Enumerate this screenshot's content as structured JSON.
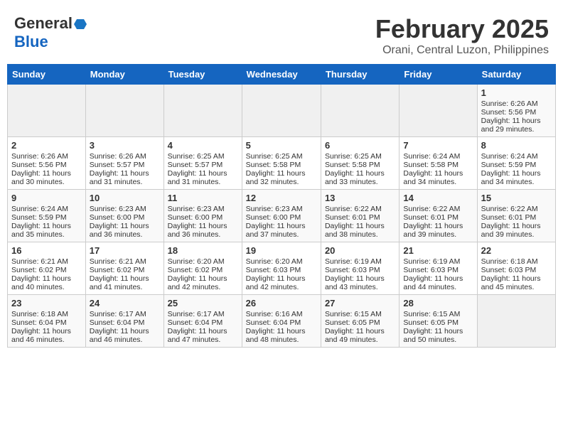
{
  "header": {
    "logo_general": "General",
    "logo_blue": "Blue",
    "month_title": "February 2025",
    "location": "Orani, Central Luzon, Philippines"
  },
  "days_of_week": [
    "Sunday",
    "Monday",
    "Tuesday",
    "Wednesday",
    "Thursday",
    "Friday",
    "Saturday"
  ],
  "weeks": [
    [
      {
        "day": "",
        "info": ""
      },
      {
        "day": "",
        "info": ""
      },
      {
        "day": "",
        "info": ""
      },
      {
        "day": "",
        "info": ""
      },
      {
        "day": "",
        "info": ""
      },
      {
        "day": "",
        "info": ""
      },
      {
        "day": "1",
        "info": "Sunrise: 6:26 AM\nSunset: 5:56 PM\nDaylight: 11 hours and 29 minutes."
      }
    ],
    [
      {
        "day": "2",
        "info": "Sunrise: 6:26 AM\nSunset: 5:56 PM\nDaylight: 11 hours and 30 minutes."
      },
      {
        "day": "3",
        "info": "Sunrise: 6:26 AM\nSunset: 5:57 PM\nDaylight: 11 hours and 31 minutes."
      },
      {
        "day": "4",
        "info": "Sunrise: 6:25 AM\nSunset: 5:57 PM\nDaylight: 11 hours and 31 minutes."
      },
      {
        "day": "5",
        "info": "Sunrise: 6:25 AM\nSunset: 5:58 PM\nDaylight: 11 hours and 32 minutes."
      },
      {
        "day": "6",
        "info": "Sunrise: 6:25 AM\nSunset: 5:58 PM\nDaylight: 11 hours and 33 minutes."
      },
      {
        "day": "7",
        "info": "Sunrise: 6:24 AM\nSunset: 5:58 PM\nDaylight: 11 hours and 34 minutes."
      },
      {
        "day": "8",
        "info": "Sunrise: 6:24 AM\nSunset: 5:59 PM\nDaylight: 11 hours and 34 minutes."
      }
    ],
    [
      {
        "day": "9",
        "info": "Sunrise: 6:24 AM\nSunset: 5:59 PM\nDaylight: 11 hours and 35 minutes."
      },
      {
        "day": "10",
        "info": "Sunrise: 6:23 AM\nSunset: 6:00 PM\nDaylight: 11 hours and 36 minutes."
      },
      {
        "day": "11",
        "info": "Sunrise: 6:23 AM\nSunset: 6:00 PM\nDaylight: 11 hours and 36 minutes."
      },
      {
        "day": "12",
        "info": "Sunrise: 6:23 AM\nSunset: 6:00 PM\nDaylight: 11 hours and 37 minutes."
      },
      {
        "day": "13",
        "info": "Sunrise: 6:22 AM\nSunset: 6:01 PM\nDaylight: 11 hours and 38 minutes."
      },
      {
        "day": "14",
        "info": "Sunrise: 6:22 AM\nSunset: 6:01 PM\nDaylight: 11 hours and 39 minutes."
      },
      {
        "day": "15",
        "info": "Sunrise: 6:22 AM\nSunset: 6:01 PM\nDaylight: 11 hours and 39 minutes."
      }
    ],
    [
      {
        "day": "16",
        "info": "Sunrise: 6:21 AM\nSunset: 6:02 PM\nDaylight: 11 hours and 40 minutes."
      },
      {
        "day": "17",
        "info": "Sunrise: 6:21 AM\nSunset: 6:02 PM\nDaylight: 11 hours and 41 minutes."
      },
      {
        "day": "18",
        "info": "Sunrise: 6:20 AM\nSunset: 6:02 PM\nDaylight: 11 hours and 42 minutes."
      },
      {
        "day": "19",
        "info": "Sunrise: 6:20 AM\nSunset: 6:03 PM\nDaylight: 11 hours and 42 minutes."
      },
      {
        "day": "20",
        "info": "Sunrise: 6:19 AM\nSunset: 6:03 PM\nDaylight: 11 hours and 43 minutes."
      },
      {
        "day": "21",
        "info": "Sunrise: 6:19 AM\nSunset: 6:03 PM\nDaylight: 11 hours and 44 minutes."
      },
      {
        "day": "22",
        "info": "Sunrise: 6:18 AM\nSunset: 6:03 PM\nDaylight: 11 hours and 45 minutes."
      }
    ],
    [
      {
        "day": "23",
        "info": "Sunrise: 6:18 AM\nSunset: 6:04 PM\nDaylight: 11 hours and 46 minutes."
      },
      {
        "day": "24",
        "info": "Sunrise: 6:17 AM\nSunset: 6:04 PM\nDaylight: 11 hours and 46 minutes."
      },
      {
        "day": "25",
        "info": "Sunrise: 6:17 AM\nSunset: 6:04 PM\nDaylight: 11 hours and 47 minutes."
      },
      {
        "day": "26",
        "info": "Sunrise: 6:16 AM\nSunset: 6:04 PM\nDaylight: 11 hours and 48 minutes."
      },
      {
        "day": "27",
        "info": "Sunrise: 6:15 AM\nSunset: 6:05 PM\nDaylight: 11 hours and 49 minutes."
      },
      {
        "day": "28",
        "info": "Sunrise: 6:15 AM\nSunset: 6:05 PM\nDaylight: 11 hours and 50 minutes."
      },
      {
        "day": "",
        "info": ""
      }
    ]
  ]
}
